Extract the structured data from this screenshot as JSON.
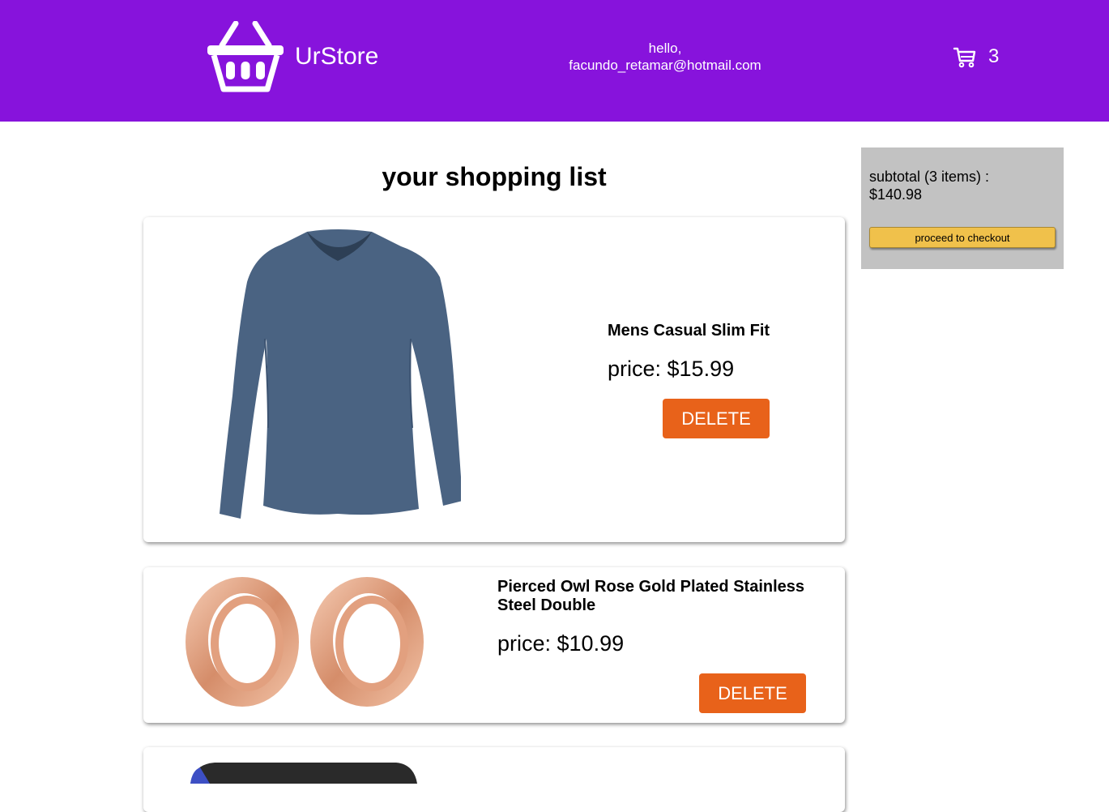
{
  "header": {
    "brand": "UrStore",
    "greeting_line1": "hello,",
    "greeting_line2": "facundo_retamar@hotmail.com",
    "cart_count": "3",
    "background_color": "#8713dc"
  },
  "main": {
    "title": "your shopping list",
    "items": [
      {
        "title": "Mens Casual Slim Fit",
        "price": "price: $15.99",
        "delete_label": "DELETE",
        "image": "blue-long-sleeve-shirt"
      },
      {
        "title": "Pierced Owl Rose Gold Plated Stainless Steel Double",
        "price": "price: $10.99",
        "delete_label": "DELETE",
        "image": "rose-gold-ear-plugs"
      },
      {
        "title": "",
        "price": "",
        "delete_label": "",
        "image": "dark-product-partial"
      }
    ]
  },
  "sidebar": {
    "subtotal_line1": "subtotal (3 items) :",
    "subtotal_line2": "$140.98",
    "checkout_label": "proceed to checkout"
  },
  "colors": {
    "delete_button": "#e8621a",
    "checkout_button": "#f0c14b",
    "sidebar_background": "#c2c2c2"
  }
}
